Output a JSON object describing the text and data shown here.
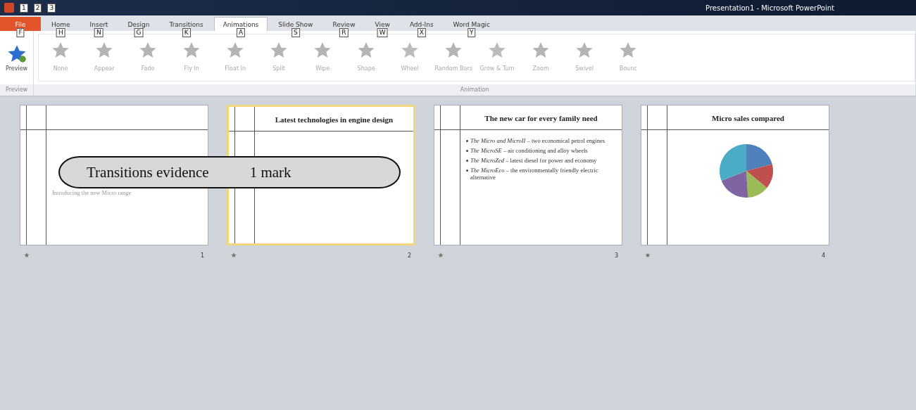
{
  "window": {
    "title": "Presentation1 - Microsoft PowerPoint"
  },
  "quick_access_keytips": [
    "1",
    "2",
    "3"
  ],
  "tabs": [
    {
      "label": "File",
      "keytip": "F",
      "selected": false,
      "kind": "file"
    },
    {
      "label": "Home",
      "keytip": "H",
      "selected": false,
      "kind": "tab"
    },
    {
      "label": "Insert",
      "keytip": "N",
      "selected": false,
      "kind": "tab"
    },
    {
      "label": "Design",
      "keytip": "G",
      "selected": false,
      "kind": "tab"
    },
    {
      "label": "Transitions",
      "keytip": "K",
      "selected": false,
      "kind": "tab"
    },
    {
      "label": "Animations",
      "keytip": "A",
      "selected": true,
      "kind": "tab"
    },
    {
      "label": "Slide Show",
      "keytip": "S",
      "selected": false,
      "kind": "tab"
    },
    {
      "label": "Review",
      "keytip": "R",
      "selected": false,
      "kind": "tab"
    },
    {
      "label": "View",
      "keytip": "W",
      "selected": false,
      "kind": "tab"
    },
    {
      "label": "Add-Ins",
      "keytip": "X",
      "selected": false,
      "kind": "tab"
    },
    {
      "label": "Word Magic",
      "keytip": "Y",
      "selected": false,
      "kind": "tab"
    }
  ],
  "preview_group": {
    "button": "Preview",
    "group_label": "Preview"
  },
  "animation_group": {
    "group_label": "Animation",
    "effects": [
      "None",
      "Appear",
      "Fade",
      "Fly In",
      "Float In",
      "Split",
      "Wipe",
      "Shape",
      "Wheel",
      "Random Bars",
      "Grow & Turn",
      "Zoom",
      "Swivel",
      "Bounc"
    ]
  },
  "slides": [
    {
      "number": "1",
      "selected": false,
      "kind": "title",
      "subtitle": "Introducing the new Micro range"
    },
    {
      "number": "2",
      "selected": true,
      "kind": "bullets",
      "title": "Latest technologies in engine design"
    },
    {
      "number": "3",
      "selected": false,
      "kind": "bullets",
      "title": "The new car for every family need",
      "bullets": [
        "*The Micro and MicroII* – two economical petrol engines",
        "*The MicroSE* – air conditioning and alloy wheels",
        "*The MicroZed* – latest diesel for power and economy",
        "*The MicroEco* – the environmentally friendly electric alternative"
      ]
    },
    {
      "number": "4",
      "selected": false,
      "kind": "chart",
      "title": "Micro sales compared"
    }
  ],
  "callout": {
    "label": "Transitions evidence",
    "value": "1 mark"
  }
}
